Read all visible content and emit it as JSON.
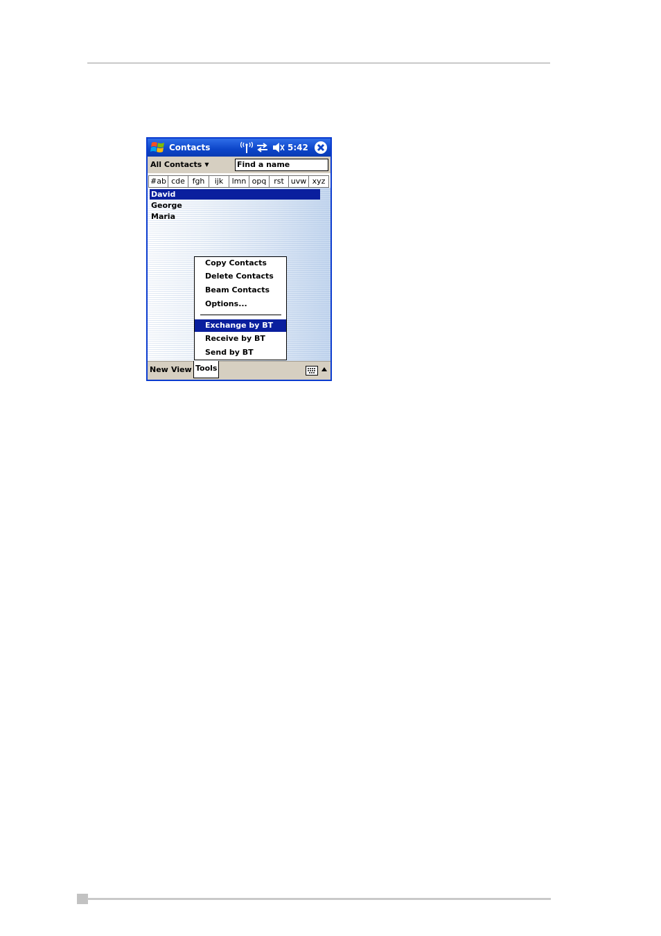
{
  "window": {
    "title": "Contacts",
    "clock": "5:42"
  },
  "filter": {
    "category": "All Contacts",
    "find_placeholder": "Find a name"
  },
  "tabs": [
    "#ab",
    "cde",
    "fgh",
    "ijk",
    "lmn",
    "opq",
    "rst",
    "uvw",
    "xyz"
  ],
  "contacts": [
    {
      "name": "David",
      "selected": true
    },
    {
      "name": "George",
      "selected": false
    },
    {
      "name": "Maria",
      "selected": false
    }
  ],
  "tools_menu": {
    "items_top": [
      "Copy Contacts",
      "Delete Contacts",
      "Beam Contacts",
      "Options..."
    ],
    "items_bottom": [
      "Exchange by BT",
      "Receive by BT",
      "Send by BT"
    ],
    "selected": "Exchange by BT"
  },
  "menubar": {
    "new_label": "New",
    "view_label": "View",
    "tools_label": "Tools"
  },
  "colors": {
    "titlebar": "#0c45c9",
    "selection": "#0a1f9e",
    "bars": "#d6cfc1"
  }
}
